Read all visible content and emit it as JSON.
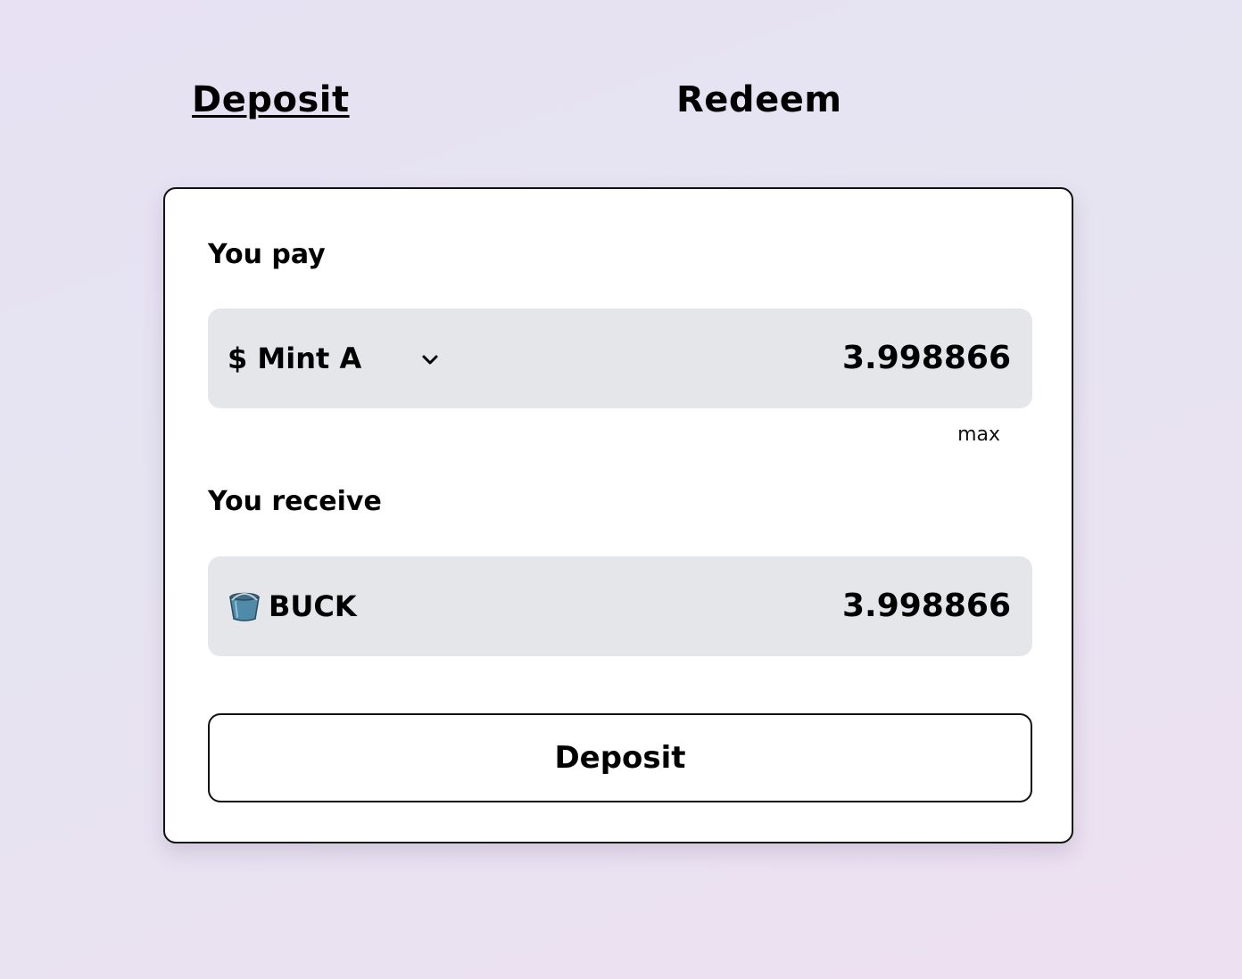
{
  "tabs": {
    "deposit_label": "Deposit",
    "redeem_label": "Redeem",
    "active": "Deposit"
  },
  "pay": {
    "label": "You pay",
    "token": "$ Mint A",
    "amount": "3.998866",
    "max_label": "max",
    "icon": "chevron-down-icon"
  },
  "receive": {
    "label": "You receive",
    "token": "BUCK",
    "amount": "3.998866",
    "icon": "bucket-icon"
  },
  "action": {
    "button_label": "Deposit"
  },
  "colors": {
    "card_background": "#ffffff",
    "field_background": "#e5e6ea",
    "border": "#111111",
    "page_gradient_start": "#e7e1f3",
    "page_gradient_end": "#ede0f1"
  }
}
